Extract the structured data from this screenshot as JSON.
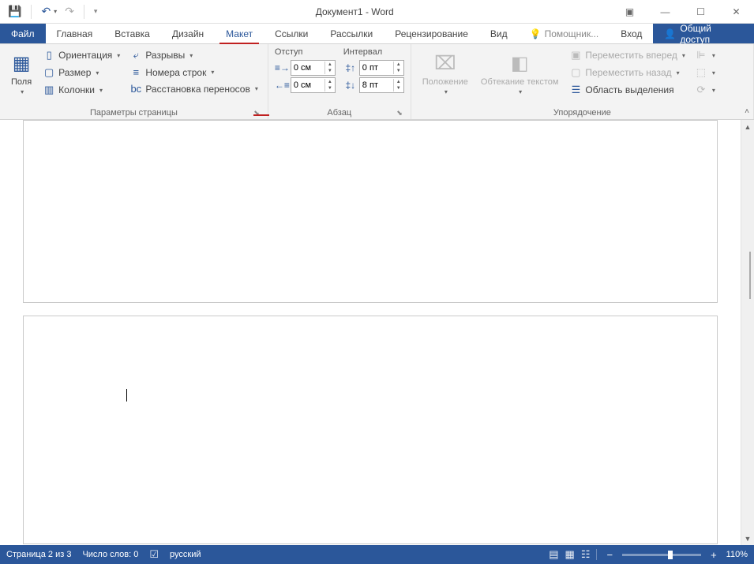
{
  "title": "Документ1 - Word",
  "qat": {
    "save": "save",
    "undo": "undo",
    "redo": "redo",
    "touch": "touch"
  },
  "wincontrols": {
    "ribbonopts": "ribbon-display-options"
  },
  "tabs": {
    "file": "Файл",
    "home": "Главная",
    "insert": "Вставка",
    "design": "Дизайн",
    "layout": "Макет",
    "references": "Ссылки",
    "mailings": "Рассылки",
    "review": "Рецензирование",
    "view": "Вид",
    "tellme": "Помощник...",
    "signin": "Вход",
    "share": "Общий доступ"
  },
  "ribbon": {
    "pagesetup": {
      "label": "Параметры страницы",
      "margins": "Поля",
      "orientation": "Ориентация",
      "size": "Размер",
      "columns": "Колонки",
      "breaks": "Разрывы",
      "linenum": "Номера строк",
      "hyphen": "Расстановка переносов"
    },
    "paragraph": {
      "label": "Абзац",
      "indent_hdr": "Отступ",
      "spacing_hdr": "Интервал",
      "indent_left": "0 см",
      "indent_right": "0 см",
      "space_before": "0 пт",
      "space_after": "8 пт"
    },
    "arrange": {
      "label": "Упорядочение",
      "position": "Положение",
      "wrap": "Обтекание текстом",
      "forward": "Переместить вперед",
      "backward": "Переместить назад",
      "selpane": "Область выделения"
    }
  },
  "status": {
    "page": "Страница 2 из 3",
    "words": "Число слов: 0",
    "lang": "русский",
    "zoom": "110%"
  }
}
